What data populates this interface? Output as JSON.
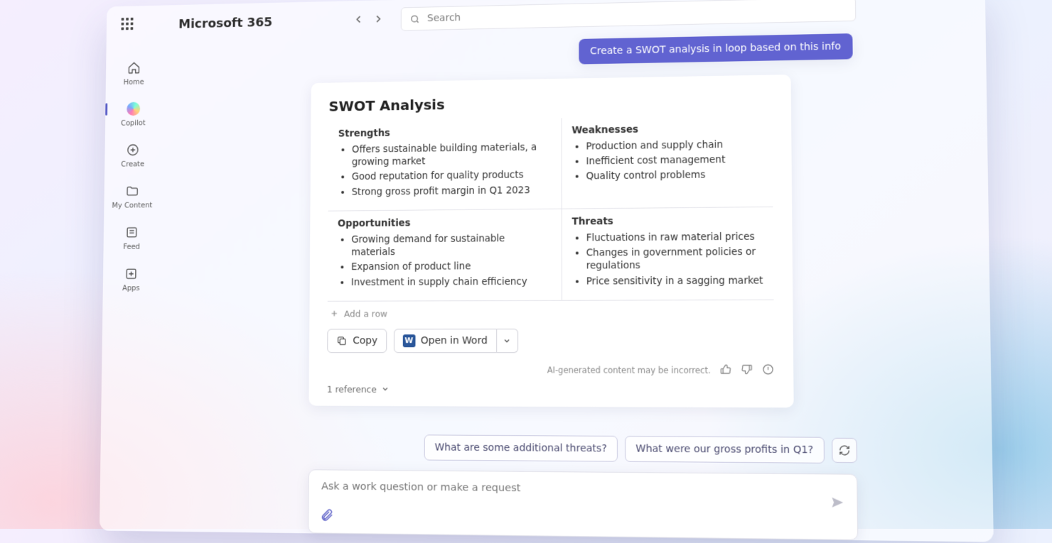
{
  "brand": "Microsoft 365",
  "search": {
    "placeholder": "Search"
  },
  "rail": {
    "home": "Home",
    "copilot": "Copilot",
    "create": "Create",
    "mycontent": "My Content",
    "feed": "Feed",
    "apps": "Apps"
  },
  "chat": {
    "user_prompt": "Create a SWOT analysis in loop based on this info",
    "card_title": "SWOT Analysis",
    "swot": {
      "strengths_h": "Strengths",
      "strengths": [
        "Offers sustainable building materials, a growing market",
        "Good reputation for quality products",
        "Strong gross profit margin in Q1 2023"
      ],
      "weaknesses_h": "Weaknesses",
      "weaknesses": [
        "Production and supply chain",
        "Inefficient cost management",
        "Quality control problems"
      ],
      "opportunities_h": "Opportunities",
      "opportunities": [
        "Growing demand for sustainable materials",
        "Expansion of product line",
        "Investment in supply chain efficiency"
      ],
      "threats_h": "Threats",
      "threats": [
        "Fluctuations in raw material prices",
        "Changes in government policies or regulations",
        "Price sensitivity in a sagging market"
      ]
    },
    "add_row": "Add a row",
    "copy_btn": "Copy",
    "open_word_btn": "Open in Word",
    "disclaimer": "AI-generated content may be incorrect.",
    "references": "1 reference"
  },
  "suggestions": {
    "s1": "What are some additional threats?",
    "s2": "What were our gross profits in Q1?"
  },
  "composer": {
    "placeholder": "Ask a work question or make a request"
  }
}
